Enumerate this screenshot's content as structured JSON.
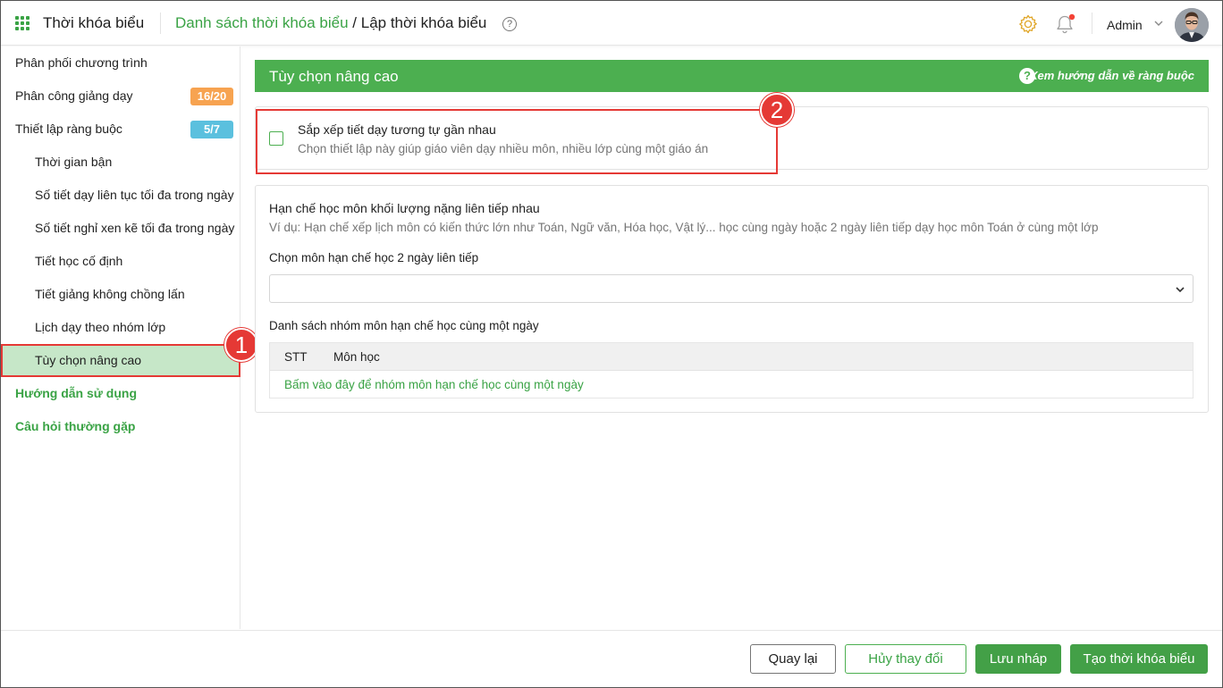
{
  "header": {
    "app_title": "Thời khóa biểu",
    "breadcrumb_link": "Danh sách thời khóa biểu",
    "breadcrumb_sep": " / ",
    "breadcrumb_current": "Lập thời khóa biểu",
    "help_glyph": "?",
    "user_name": "Admin",
    "notification_dot_color": "#f44336"
  },
  "sidebar": {
    "items": [
      {
        "label": "Phân phối chương trình"
      },
      {
        "label": "Phân công giảng dạy",
        "badge": "16/20"
      },
      {
        "label": "Thiết lập ràng buộc",
        "badge": "5/7"
      },
      {
        "label": "Thời gian bận"
      },
      {
        "label": "Số tiết dạy liên tục tối đa trong ngày"
      },
      {
        "label": "Số tiết nghỉ xen kẽ tối đa trong ngày"
      },
      {
        "label": "Tiết học cố định"
      },
      {
        "label": "Tiết giảng không chồng lấn"
      },
      {
        "label": "Lịch dạy theo nhóm lớp"
      },
      {
        "label": "Tùy chọn nâng cao"
      },
      {
        "label": "Hướng dẫn sử dụng"
      },
      {
        "label": "Câu hỏi thường gặp"
      }
    ],
    "active_index": 9
  },
  "markers": {
    "one": "1",
    "two": "2"
  },
  "main": {
    "section_title": "Tùy chọn nâng cao",
    "guide_link": "Xem hướng dẫn về ràng buộc",
    "guide_glyph": "?",
    "option": {
      "title": "Sắp xếp tiết dạy tương tự gần nhau",
      "description": "Chọn thiết lập này giúp giáo viên dạy nhiều môn, nhiều lớp cùng một giáo án",
      "checked": false
    },
    "restriction": {
      "title": "Hạn chế học môn khối lượng nặng liên tiếp nhau",
      "example": "Ví dụ: Hạn chế xếp lịch môn có kiến thức lớn như Toán, Ngữ văn, Hóa học, Vật lý... học cùng ngày hoặc 2 ngày liên tiếp dạy học môn Toán ở cùng một lớp",
      "select_label": "Chọn môn hạn chế học 2 ngày liên tiếp",
      "select_value": "",
      "group_label": "Danh sách nhóm môn hạn chế học cùng một ngày",
      "columns": [
        "STT",
        "Môn học"
      ],
      "add_link": "Bấm vào đây để nhóm môn hạn chế học cùng một ngày"
    }
  },
  "footer": {
    "back": "Quay lại",
    "cancel": "Hủy thay đổi",
    "draft": "Lưu nháp",
    "create": "Tạo thời khóa biểu"
  },
  "colors": {
    "accent": "#4caf50",
    "highlight": "#e53935",
    "badge_orange": "#f7a350",
    "badge_blue": "#5bc0de",
    "active_bg": "#c6e7c8"
  }
}
